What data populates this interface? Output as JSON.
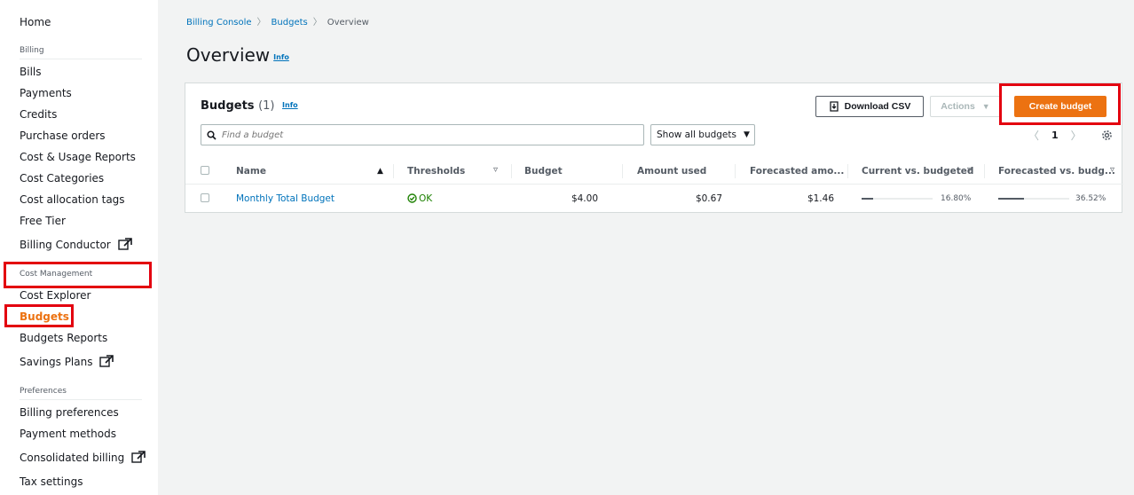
{
  "sidebar": {
    "top_items": [
      {
        "label": "Home"
      }
    ],
    "sections": [
      {
        "title": "Billing",
        "items": [
          "Bills",
          "Payments",
          "Credits",
          "Purchase orders",
          "Cost & Usage Reports",
          "Cost Categories",
          "Cost allocation tags",
          "Free Tier",
          "Billing Conductor"
        ]
      },
      {
        "title": "Cost Management",
        "items": [
          "Cost Explorer",
          "Budgets",
          "Budgets Reports",
          "Savings Plans"
        ]
      },
      {
        "title": "Preferences",
        "items": [
          "Billing preferences",
          "Payment methods",
          "Consolidated billing",
          "Tax settings"
        ]
      }
    ],
    "active_item": "Budgets",
    "external_items": [
      "Billing Conductor",
      "Savings Plans",
      "Consolidated billing"
    ]
  },
  "breadcrumb": [
    "Billing Console",
    "Budgets",
    "Overview"
  ],
  "page": {
    "title": "Overview",
    "info": "Info"
  },
  "budgets_panel": {
    "title": "Budgets",
    "count": "(1)",
    "info": "Info",
    "download_csv_label": "Download CSV",
    "actions_label": "Actions",
    "create_label": "Create budget",
    "search_placeholder": "Find a budget",
    "filter_selected": "Show all budgets",
    "page_number": "1",
    "columns": [
      "Name",
      "Thresholds",
      "Budget",
      "Amount used",
      "Forecasted amo...",
      "Current vs. budgeted",
      "Forecasted vs. budg..."
    ],
    "rows": [
      {
        "name": "Monthly Total Budget",
        "thresholds": "OK",
        "budget": "$4.00",
        "amount_used": "$0.67",
        "forecasted_amount": "$1.46",
        "current_vs_budgeted": "16.80%",
        "current_vs_budgeted_fraction": 0.168,
        "forecasted_vs_budgeted": "36.52%",
        "forecasted_vs_budgeted_fraction": 0.3652
      }
    ]
  },
  "colors": {
    "accent": "#ec7211",
    "link": "#0073bb",
    "ok": "#1d8102",
    "highlight": "#e3000f"
  }
}
